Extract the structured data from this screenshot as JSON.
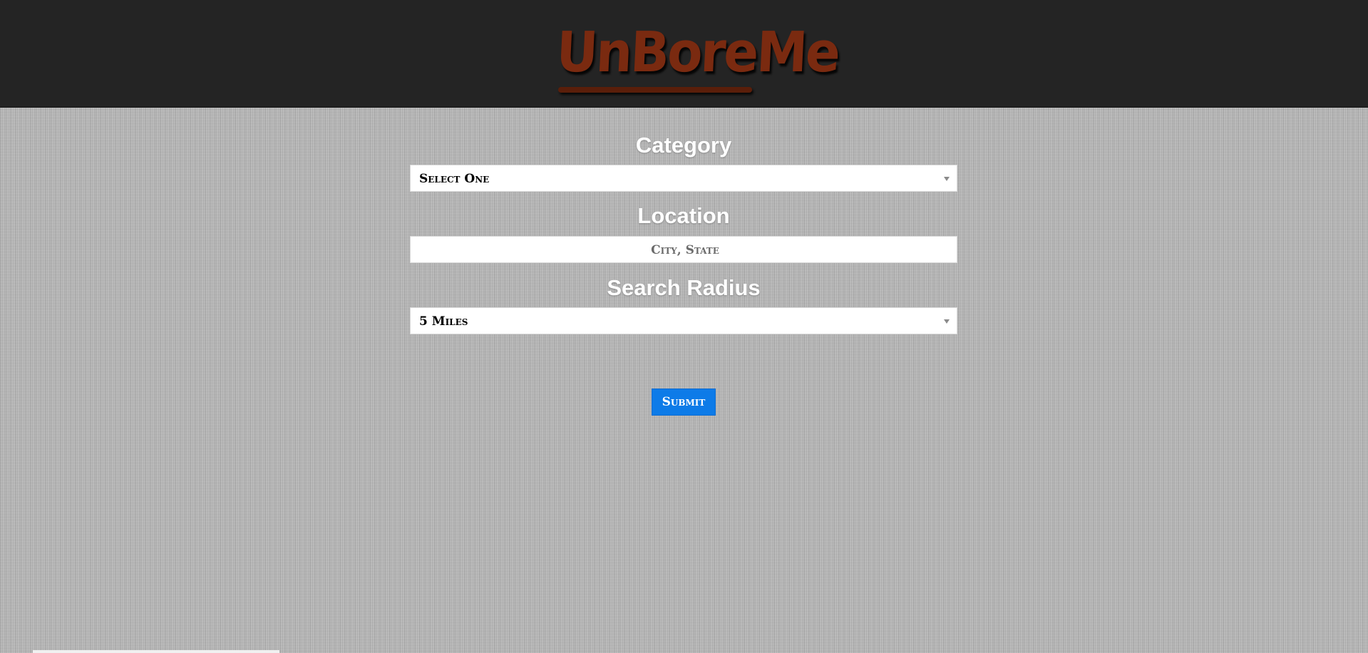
{
  "header": {
    "logo_text": "UnBoreMe",
    "background_color": "#242424",
    "logo_color": "#7a2a10"
  },
  "form": {
    "category": {
      "label": "Category",
      "selected_value": "Select One"
    },
    "location": {
      "label": "Location",
      "value": "",
      "placeholder": "City, State"
    },
    "radius": {
      "label": "Search Radius",
      "selected_value": "5 Miles"
    },
    "submit_label": "Submit",
    "submit_color": "#0d7be8"
  },
  "icons": {
    "select_arrow": "chevron-down-icon"
  }
}
